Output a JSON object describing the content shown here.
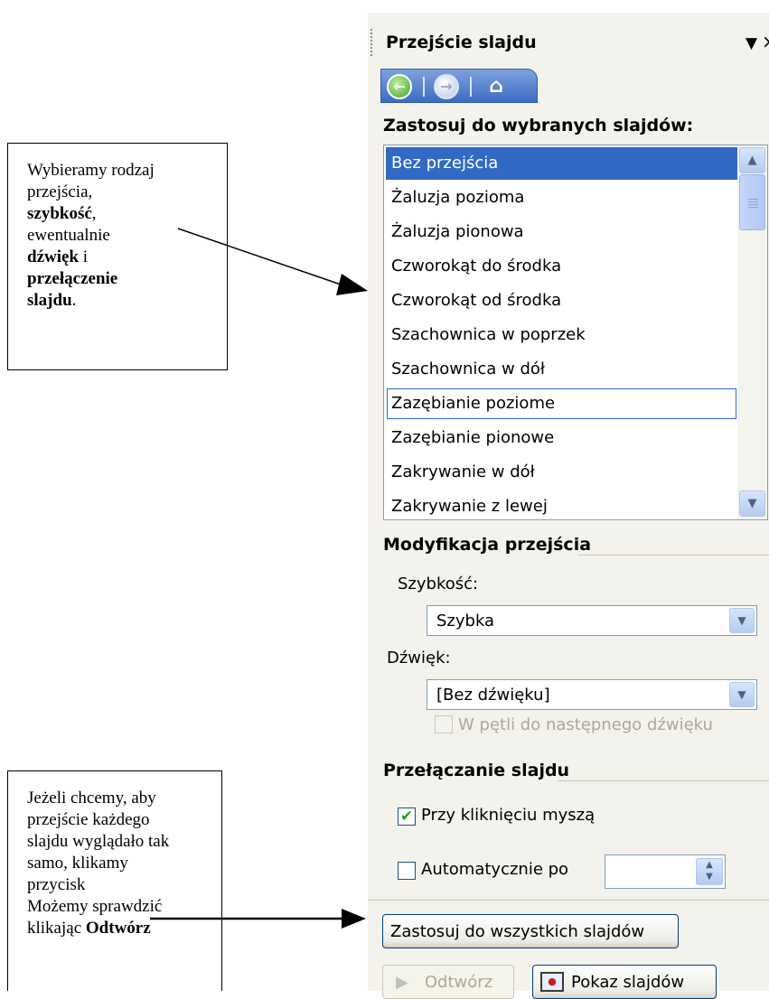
{
  "annotations": {
    "callout_1": {
      "line1": "Wybieramy rodzaj",
      "line2": "przejścia,",
      "line3_bold": "szybkość",
      "line3_rest": ",",
      "line4": "ewentualnie",
      "line5_bold": "dźwięk",
      "line5_rest": " i",
      "line6_bold": "przełączenie",
      "line7_bold": "slajdu",
      "line7_rest": "."
    },
    "callout_2": {
      "line1": "Jeżeli chcemy, aby",
      "line2": "przejście każdego",
      "line3": "slajdu wyglądało tak",
      "line4": "samo, klikamy",
      "line5": "przycisk",
      "line6": "Możemy sprawdzić",
      "line7_plain": "klikając ",
      "line7_bold": "Odtwórz"
    }
  },
  "pane": {
    "title": "Przejście slajdu",
    "dropdown_icon": "▼",
    "close_icon": "×",
    "nav": {
      "back_icon": "back-arrow-icon",
      "forward_icon": "forward-arrow-icon",
      "home_icon": "home-icon"
    }
  },
  "transitions": {
    "heading": "Zastosuj do wybranych slajdów:",
    "items": [
      "Bez przejścia",
      "Żaluzja pozioma",
      "Żaluzja pionowa",
      "Czworokąt do środka",
      "Czworokąt od środka",
      "Szachownica w poprzek",
      "Szachownica w dół",
      "Zazębianie poziome",
      "Zazębianie pionowe",
      "Zakrywanie w dół",
      "Zakrywanie z lewej"
    ],
    "selected_index": 0,
    "focused_index": 7
  },
  "modify": {
    "heading": "Modyfikacja przejścia",
    "speed_label": "Szybkość:",
    "speed_value": "Szybka",
    "sound_label": "Dźwięk:",
    "sound_value": "[Bez dźwięku]",
    "loop_label": "W pętli do następnego dźwięku",
    "loop_checked": false,
    "loop_enabled": false
  },
  "advance": {
    "heading": "Przełączanie slajdu",
    "on_click_label": "Przy kliknięciu myszą",
    "on_click_checked": true,
    "auto_label": "Automatycznie po",
    "auto_checked": false,
    "auto_value": ""
  },
  "buttons": {
    "apply_all": "Zastosuj do wszystkich slajdów",
    "play": "Odtwórz",
    "slideshow": "Pokaz slajdów"
  },
  "colors": {
    "selection": "#316ac5",
    "pane_bg": "#f3f2ec",
    "check_green": "#21a121"
  }
}
